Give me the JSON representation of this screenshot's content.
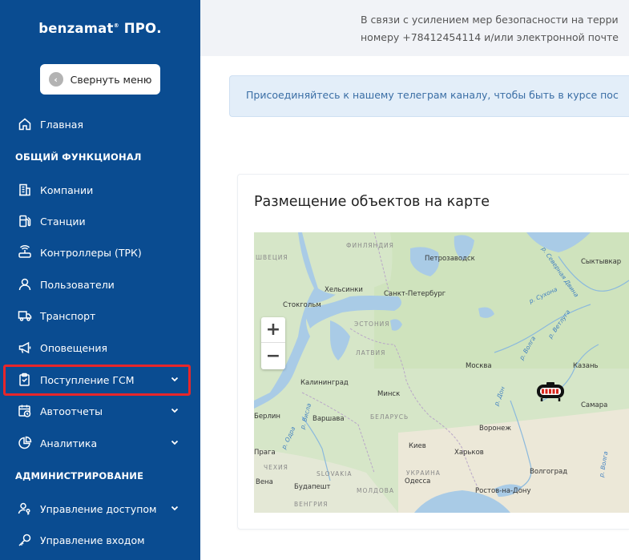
{
  "sidebar": {
    "logo_main": "benzamat",
    "logo_mark": "®",
    "logo_suffix": " ПРО.",
    "collapse_label": "Свернуть меню",
    "collapse_icon": "arrow-left-circle-icon",
    "section_general": "ОБЩИЙ ФУНКЦИОНАЛ",
    "section_admin": "АДМИНИСТРИРОВАНИЕ",
    "items": [
      {
        "label": "Главная",
        "icon": "home-icon"
      },
      {
        "label": "Компании",
        "icon": "building-icon"
      },
      {
        "label": "Станции",
        "icon": "fuel-station-icon"
      },
      {
        "label": "Контроллеры (ТРК)",
        "icon": "router-icon"
      },
      {
        "label": "Пользователи",
        "icon": "user-icon"
      },
      {
        "label": "Транспорт",
        "icon": "truck-icon"
      },
      {
        "label": "Оповещения",
        "icon": "megaphone-icon"
      },
      {
        "label": "Поступление ГСМ",
        "icon": "clipboard-icon"
      },
      {
        "label": "Автоотчеты",
        "icon": "calendar-clock-icon"
      },
      {
        "label": "Аналитика",
        "icon": "chart-icon"
      },
      {
        "label": "Управление доступом",
        "icon": "user-key-icon"
      },
      {
        "label": "Управление входом",
        "icon": "key-icon"
      }
    ],
    "highlight_color": "#e8262a",
    "bg_color": "#0a4c91"
  },
  "topbar": {
    "line1": "В связи с усилением мер безопасности на терри",
    "line2": "номеру +78412454114 и/или электронной почте"
  },
  "notice": {
    "text": "Присоединяйтесь к нашему телеграм каналу, чтобы быть в курсе пос"
  },
  "map_card": {
    "title": "Размещение объектов на карте",
    "zoom_in": "+",
    "zoom_out": "−",
    "labels": {
      "finland": "ФИНЛЯНДИЯ",
      "sweden": "ШВЕЦИЯ",
      "estonia": "ЭСТОНИЯ",
      "latvia": "ЛАТВИЯ",
      "belarus": "БЕЛАРУСЬ",
      "ukraine": "УКРАИНА",
      "slovakia": "SLOVAKIA",
      "czechia": "ЧЕХИЯ",
      "hungary": "ВЕНГРИЯ",
      "moldova": "МОЛДОВА",
      "petrozavodsk": "Петрозаводск",
      "syktyvkar": "Сыктывкар",
      "helsinki": "Хельсинки",
      "spb": "Санкт-Петербург",
      "stockholm": "Стокгольм",
      "moscow": "Москва",
      "kazan": "Казань",
      "kaliningrad": "Калининград",
      "minsk": "Минск",
      "berlin": "Берлин",
      "warsaw": "Варшава",
      "samara": "Самара",
      "voronezh": "Воронеж",
      "kyiv": "Киев",
      "kharkiv": "Харьков",
      "volgograd": "Волгоград",
      "prague": "Прага",
      "vienna": "Вена",
      "budapest": "Будапешт",
      "odesa": "Одесса",
      "rostov": "Ростов-на-Дону",
      "r_sukhona": "р. Сухона",
      "r_vetluga": "р. Ветлуга",
      "r_volga": "р. Волга",
      "r_don": "р. Дон",
      "r_sev_dvina": "р. Северная Двина",
      "r_oder": "р. Одра",
      "r_vistula": "р. Висла",
      "r_volga2": "р. Волга"
    }
  }
}
